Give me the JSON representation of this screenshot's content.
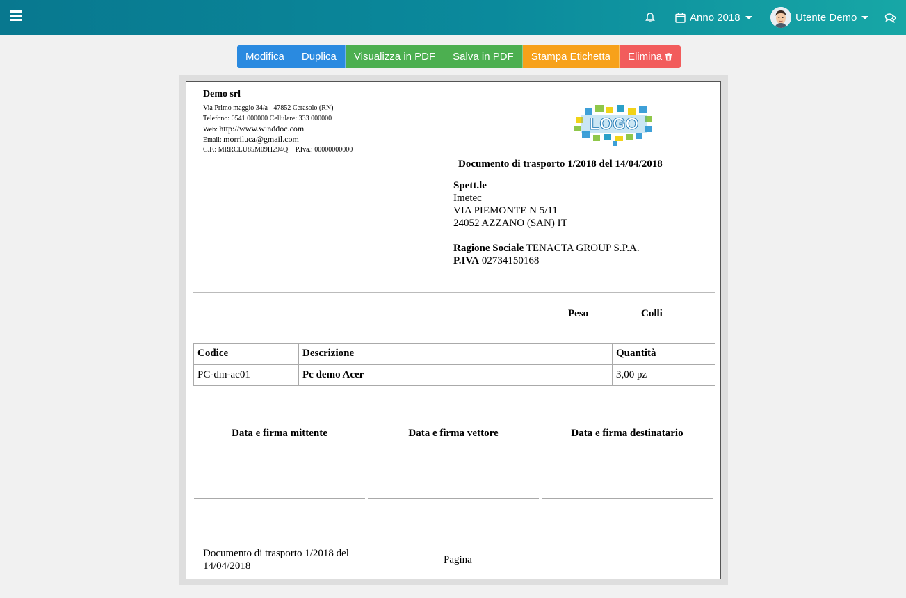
{
  "topbar": {
    "year_label": "Anno 2018",
    "user_label": "Utente Demo"
  },
  "toolbar": {
    "edit": "Modifica",
    "duplicate": "Duplica",
    "view_pdf": "Visualizza in PDF",
    "save_pdf": "Salva in PDF",
    "print_label": "Stampa Etichetta",
    "delete": "Elimina"
  },
  "colors": {
    "topbar_start": "#08788f",
    "topbar_end": "#17a7a6",
    "blue": "#2a8ae0",
    "green": "#4caf50",
    "orange": "#f7a11a",
    "red": "#f25c5c"
  },
  "company": {
    "name": "Demo srl",
    "address": "Via Primo maggio 34/a - 47852 Cerasolo (RN)",
    "phone": "Telefono: 0541 000000 Cellulare: 333 000000",
    "web_label": "Web:",
    "web": "http://www.winddoc.com",
    "email_label": "Email:",
    "email": "morriluca@gmail.com",
    "tax": "C.F.: MRRCLU85M09H294Q",
    "vat": "P.Iva.: 00000000000",
    "logo_text": "LOGO"
  },
  "document": {
    "title": "Documento di trasporto 1/2018 del 14/04/2018"
  },
  "recipient": {
    "salutation": "Spett.le",
    "name": "Imetec",
    "street": "VIA PIEMONTE N 5/11",
    "city": "24052 AZZANO (SAN) IT",
    "company_label": "Ragione Sociale",
    "company_value": "TENACTA GROUP S.P.A.",
    "vat_label": "P.IVA",
    "vat_value": "02734150168"
  },
  "shipping": {
    "weight_label": "Peso",
    "packages_label": "Colli"
  },
  "items_table": {
    "headers": [
      "Codice",
      "Descrizione",
      "Quantità"
    ],
    "rows": [
      [
        "PC-dm-ac01",
        "Pc demo Acer",
        "3,00 pz"
      ]
    ]
  },
  "signatures": {
    "sender": "Data e firma mittente",
    "carrier": "Data e firma vettore",
    "recipient": "Data e firma destinatario"
  },
  "footer": {
    "doc_ref": "Documento di trasporto 1/2018 del 14/04/2018",
    "page_label": "Pagina"
  }
}
